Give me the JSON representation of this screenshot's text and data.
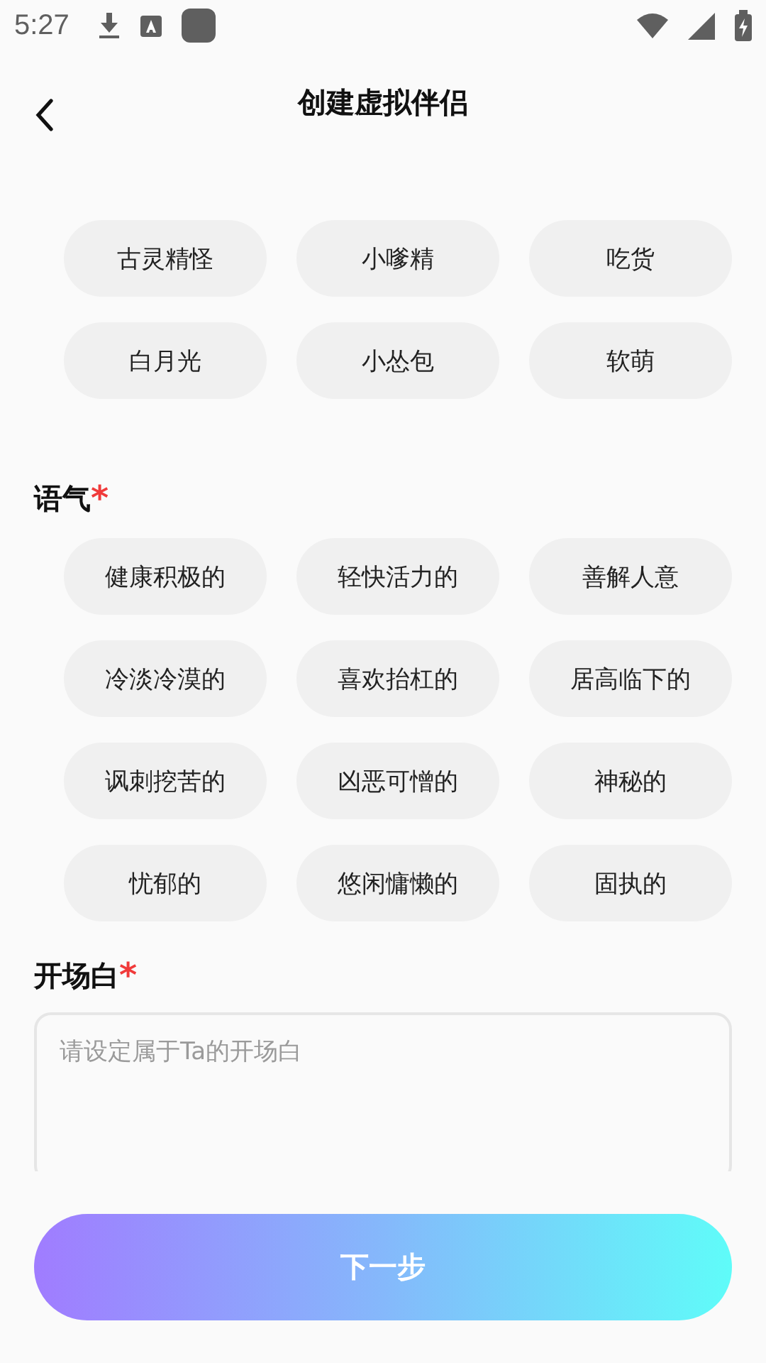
{
  "status_bar": {
    "time": "5:27"
  },
  "header": {
    "title": "创建虚拟伴侣"
  },
  "personality_tags": [
    "古灵精怪",
    "小嗲精",
    "吃货",
    "白月光",
    "小怂包",
    "软萌"
  ],
  "tone": {
    "label": "语气",
    "required_mark": "*",
    "tags": [
      "健康积极的",
      "轻快活力的",
      "善解人意",
      "冷淡冷漠的",
      "喜欢抬杠的",
      "居高临下的",
      "讽刺挖苦的",
      "凶恶可憎的",
      "神秘的",
      "忧郁的",
      "悠闲慵懒的",
      "固执的"
    ]
  },
  "opening_line": {
    "label": "开场白",
    "required_mark": "*",
    "placeholder": "请设定属于Ta的开场白"
  },
  "next_button": {
    "label": "下一步"
  }
}
